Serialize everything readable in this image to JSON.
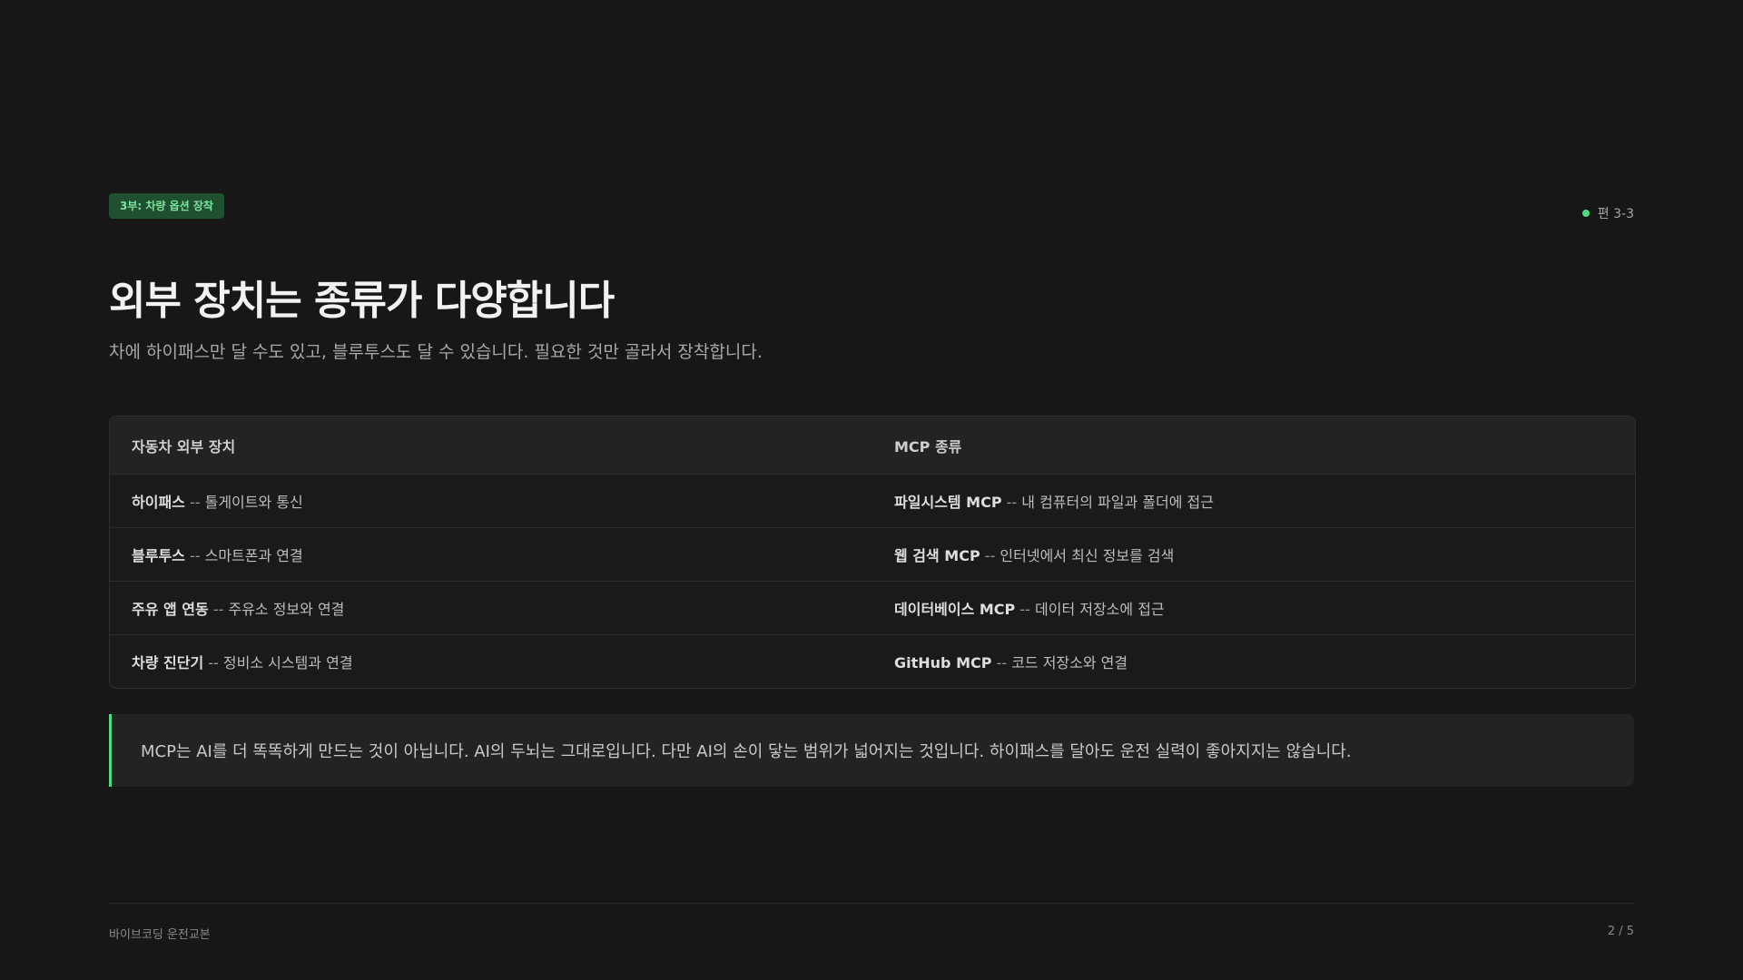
{
  "header": {
    "section_badge": "3부: 차량 옵션 장착",
    "episode": "편 3-3"
  },
  "title": "외부 장치는 종류가 다양합니다",
  "subtitle": "차에 하이패스만 달 수도 있고, 블루투스도 달 수 있습니다. 필요한 것만 골라서 장착합니다.",
  "table": {
    "headers": [
      "자동차 외부 장치",
      "MCP 종류"
    ],
    "rows": [
      {
        "left": {
          "name": "하이패스",
          "sep": " -- ",
          "desc": "톨게이트와 통신"
        },
        "right": {
          "name": "파일시스템 MCP",
          "sep": " -- ",
          "desc": "내 컴퓨터의 파일과 폴더에 접근"
        }
      },
      {
        "left": {
          "name": "블루투스",
          "sep": " -- ",
          "desc": "스마트폰과 연결"
        },
        "right": {
          "name": "웹 검색 MCP",
          "sep": " -- ",
          "desc": "인터넷에서 최신 정보를 검색"
        }
      },
      {
        "left": {
          "name": "주유 앱 연동",
          "sep": " -- ",
          "desc": "주유소 정보와 연결"
        },
        "right": {
          "name": "데이터베이스 MCP",
          "sep": " -- ",
          "desc": "데이터 저장소에 접근"
        }
      },
      {
        "left": {
          "name": "차량 진단기",
          "sep": " -- ",
          "desc": "정비소 시스템과 연결"
        },
        "right": {
          "name": "GitHub MCP",
          "sep": " -- ",
          "desc": "코드 저장소와 연결"
        }
      }
    ]
  },
  "callout": "MCP는 AI를 더 똑똑하게 만드는 것이 아닙니다. AI의 두뇌는 그대로입니다. 다만 AI의 손이 닿는 범위가 넓어지는 것입니다. 하이패스를 달아도 운전 실력이 좋아지지는 않습니다.",
  "footer": {
    "left": "바이브코딩 운전교본",
    "right": "2 / 5"
  },
  "colors": {
    "accent": "#4ade80",
    "badge_bg": "#1f5130",
    "background": "#171717"
  }
}
